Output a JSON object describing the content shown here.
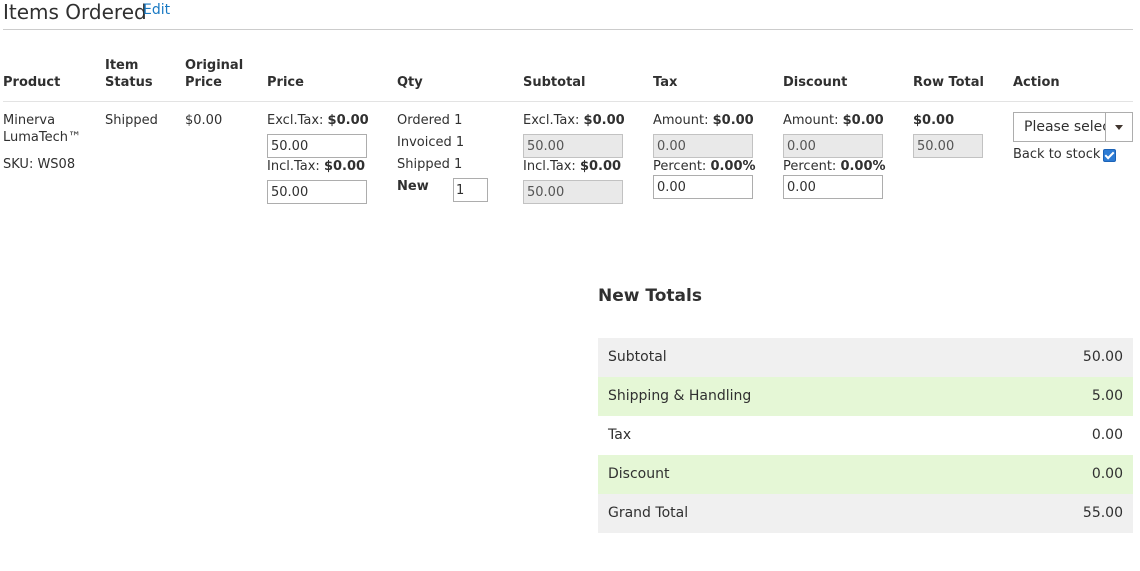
{
  "header": {
    "title": "Items Ordered",
    "edit_label": "Edit"
  },
  "columns": {
    "product": "Product",
    "item_status_1": "Item",
    "item_status_2": "Status",
    "original_price_1": "Original",
    "original_price_2": "Price",
    "price": "Price",
    "qty": "Qty",
    "subtotal": "Subtotal",
    "tax": "Tax",
    "discount": "Discount",
    "row_total": "Row Total",
    "action": "Action"
  },
  "item": {
    "name_1": "Minerva",
    "name_2": "LumaTech™",
    "sku": "SKU: WS08",
    "status": "Shipped",
    "original_price": "$0.00",
    "price": {
      "excl_label": "Excl.Tax:",
      "excl_value": "$0.00",
      "excl_input": "50.00",
      "incl_label": "Incl.Tax:",
      "incl_value": "$0.00",
      "incl_input": "50.00"
    },
    "qty": {
      "ordered_label": "Ordered",
      "ordered": "1",
      "invoiced_label": "Invoiced",
      "invoiced": "1",
      "shipped_label": "Shipped",
      "shipped": "1",
      "new_label": "New",
      "new_input": "1"
    },
    "subtotal": {
      "excl_label": "Excl.Tax:",
      "excl_value": "$0.00",
      "excl_input": "50.00",
      "incl_label": "Incl.Tax:",
      "incl_value": "$0.00",
      "incl_input": "50.00"
    },
    "tax": {
      "amount_label": "Amount:",
      "amount_value": "$0.00",
      "amount_input": "0.00",
      "percent_label": "Percent:",
      "percent_value": "0.00%",
      "percent_input": "0.00"
    },
    "discount": {
      "amount_label": "Amount:",
      "amount_value": "$0.00",
      "amount_input": "0.00",
      "percent_label": "Percent:",
      "percent_value": "0.00%",
      "percent_input": "0.00"
    },
    "row_total": {
      "value": "$0.00",
      "input": "50.00"
    },
    "action": {
      "select_value": "Please select",
      "back_to_stock": "Back to stock",
      "back_to_stock_checked": true
    }
  },
  "totals": {
    "title": "New Totals",
    "rows": [
      {
        "label": "Subtotal",
        "value": "50.00"
      },
      {
        "label": "Shipping & Handling",
        "value": "5.00"
      },
      {
        "label": "Tax",
        "value": "0.00"
      },
      {
        "label": "Discount",
        "value": "0.00"
      },
      {
        "label": "Grand Total",
        "value": "55.00"
      }
    ]
  },
  "colors": {
    "link": "#1979c3",
    "highlight_row": "#e5f7d6",
    "grey_row": "#f0f0f0",
    "checkbox": "#2d7bd4"
  }
}
